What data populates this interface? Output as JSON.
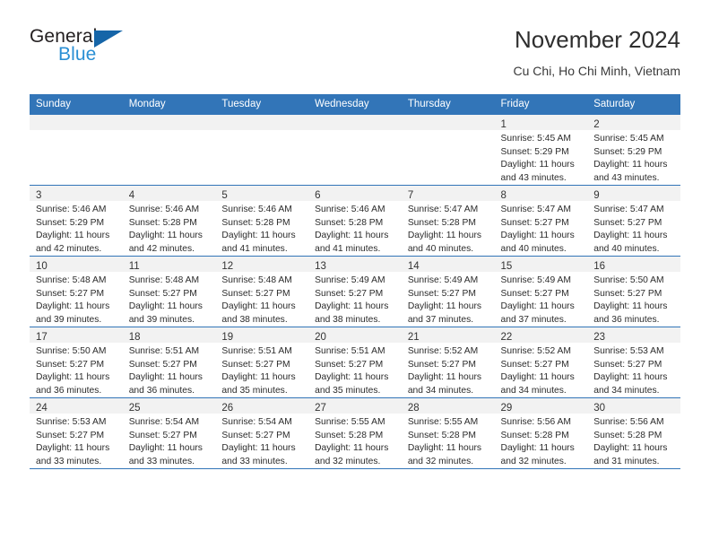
{
  "logo": {
    "word1": "General",
    "word2": "Blue",
    "triangle_color": "#1565a8",
    "blue_color": "#2a8fd4"
  },
  "header": {
    "title": "November 2024",
    "subtitle": "Cu Chi, Ho Chi Minh, Vietnam"
  },
  "theme": {
    "header_blue": "#3275b8",
    "band_gray": "#f2f2f2"
  },
  "calendar": {
    "weekday_headers": [
      "Sunday",
      "Monday",
      "Tuesday",
      "Wednesday",
      "Thursday",
      "Friday",
      "Saturday"
    ],
    "weeks": [
      [
        {
          "day": "",
          "lines": []
        },
        {
          "day": "",
          "lines": []
        },
        {
          "day": "",
          "lines": []
        },
        {
          "day": "",
          "lines": []
        },
        {
          "day": "",
          "lines": []
        },
        {
          "day": "1",
          "lines": [
            "Sunrise: 5:45 AM",
            "Sunset: 5:29 PM",
            "Daylight: 11 hours",
            "and 43 minutes."
          ]
        },
        {
          "day": "2",
          "lines": [
            "Sunrise: 5:45 AM",
            "Sunset: 5:29 PM",
            "Daylight: 11 hours",
            "and 43 minutes."
          ]
        }
      ],
      [
        {
          "day": "3",
          "lines": [
            "Sunrise: 5:46 AM",
            "Sunset: 5:29 PM",
            "Daylight: 11 hours",
            "and 42 minutes."
          ]
        },
        {
          "day": "4",
          "lines": [
            "Sunrise: 5:46 AM",
            "Sunset: 5:28 PM",
            "Daylight: 11 hours",
            "and 42 minutes."
          ]
        },
        {
          "day": "5",
          "lines": [
            "Sunrise: 5:46 AM",
            "Sunset: 5:28 PM",
            "Daylight: 11 hours",
            "and 41 minutes."
          ]
        },
        {
          "day": "6",
          "lines": [
            "Sunrise: 5:46 AM",
            "Sunset: 5:28 PM",
            "Daylight: 11 hours",
            "and 41 minutes."
          ]
        },
        {
          "day": "7",
          "lines": [
            "Sunrise: 5:47 AM",
            "Sunset: 5:28 PM",
            "Daylight: 11 hours",
            "and 40 minutes."
          ]
        },
        {
          "day": "8",
          "lines": [
            "Sunrise: 5:47 AM",
            "Sunset: 5:27 PM",
            "Daylight: 11 hours",
            "and 40 minutes."
          ]
        },
        {
          "day": "9",
          "lines": [
            "Sunrise: 5:47 AM",
            "Sunset: 5:27 PM",
            "Daylight: 11 hours",
            "and 40 minutes."
          ]
        }
      ],
      [
        {
          "day": "10",
          "lines": [
            "Sunrise: 5:48 AM",
            "Sunset: 5:27 PM",
            "Daylight: 11 hours",
            "and 39 minutes."
          ]
        },
        {
          "day": "11",
          "lines": [
            "Sunrise: 5:48 AM",
            "Sunset: 5:27 PM",
            "Daylight: 11 hours",
            "and 39 minutes."
          ]
        },
        {
          "day": "12",
          "lines": [
            "Sunrise: 5:48 AM",
            "Sunset: 5:27 PM",
            "Daylight: 11 hours",
            "and 38 minutes."
          ]
        },
        {
          "day": "13",
          "lines": [
            "Sunrise: 5:49 AM",
            "Sunset: 5:27 PM",
            "Daylight: 11 hours",
            "and 38 minutes."
          ]
        },
        {
          "day": "14",
          "lines": [
            "Sunrise: 5:49 AM",
            "Sunset: 5:27 PM",
            "Daylight: 11 hours",
            "and 37 minutes."
          ]
        },
        {
          "day": "15",
          "lines": [
            "Sunrise: 5:49 AM",
            "Sunset: 5:27 PM",
            "Daylight: 11 hours",
            "and 37 minutes."
          ]
        },
        {
          "day": "16",
          "lines": [
            "Sunrise: 5:50 AM",
            "Sunset: 5:27 PM",
            "Daylight: 11 hours",
            "and 36 minutes."
          ]
        }
      ],
      [
        {
          "day": "17",
          "lines": [
            "Sunrise: 5:50 AM",
            "Sunset: 5:27 PM",
            "Daylight: 11 hours",
            "and 36 minutes."
          ]
        },
        {
          "day": "18",
          "lines": [
            "Sunrise: 5:51 AM",
            "Sunset: 5:27 PM",
            "Daylight: 11 hours",
            "and 36 minutes."
          ]
        },
        {
          "day": "19",
          "lines": [
            "Sunrise: 5:51 AM",
            "Sunset: 5:27 PM",
            "Daylight: 11 hours",
            "and 35 minutes."
          ]
        },
        {
          "day": "20",
          "lines": [
            "Sunrise: 5:51 AM",
            "Sunset: 5:27 PM",
            "Daylight: 11 hours",
            "and 35 minutes."
          ]
        },
        {
          "day": "21",
          "lines": [
            "Sunrise: 5:52 AM",
            "Sunset: 5:27 PM",
            "Daylight: 11 hours",
            "and 34 minutes."
          ]
        },
        {
          "day": "22",
          "lines": [
            "Sunrise: 5:52 AM",
            "Sunset: 5:27 PM",
            "Daylight: 11 hours",
            "and 34 minutes."
          ]
        },
        {
          "day": "23",
          "lines": [
            "Sunrise: 5:53 AM",
            "Sunset: 5:27 PM",
            "Daylight: 11 hours",
            "and 34 minutes."
          ]
        }
      ],
      [
        {
          "day": "24",
          "lines": [
            "Sunrise: 5:53 AM",
            "Sunset: 5:27 PM",
            "Daylight: 11 hours",
            "and 33 minutes."
          ]
        },
        {
          "day": "25",
          "lines": [
            "Sunrise: 5:54 AM",
            "Sunset: 5:27 PM",
            "Daylight: 11 hours",
            "and 33 minutes."
          ]
        },
        {
          "day": "26",
          "lines": [
            "Sunrise: 5:54 AM",
            "Sunset: 5:27 PM",
            "Daylight: 11 hours",
            "and 33 minutes."
          ]
        },
        {
          "day": "27",
          "lines": [
            "Sunrise: 5:55 AM",
            "Sunset: 5:28 PM",
            "Daylight: 11 hours",
            "and 32 minutes."
          ]
        },
        {
          "day": "28",
          "lines": [
            "Sunrise: 5:55 AM",
            "Sunset: 5:28 PM",
            "Daylight: 11 hours",
            "and 32 minutes."
          ]
        },
        {
          "day": "29",
          "lines": [
            "Sunrise: 5:56 AM",
            "Sunset: 5:28 PM",
            "Daylight: 11 hours",
            "and 32 minutes."
          ]
        },
        {
          "day": "30",
          "lines": [
            "Sunrise: 5:56 AM",
            "Sunset: 5:28 PM",
            "Daylight: 11 hours",
            "and 31 minutes."
          ]
        }
      ]
    ]
  }
}
